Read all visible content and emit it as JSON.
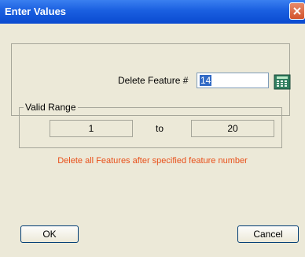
{
  "window": {
    "title": "Enter Values",
    "close_icon": "close-icon"
  },
  "feature": {
    "label": "Delete Feature #",
    "value": "14",
    "calculator_icon": "calculator-icon"
  },
  "range": {
    "legend": "Valid Range",
    "min": "1",
    "separator": "to",
    "max": "20"
  },
  "note": "Delete all Features after specified feature number",
  "buttons": {
    "ok": "OK",
    "cancel": "Cancel"
  },
  "colors": {
    "title_bar": "#0a4ad0",
    "note_text": "#e8501a",
    "dialog_bg": "#ece9d8"
  }
}
